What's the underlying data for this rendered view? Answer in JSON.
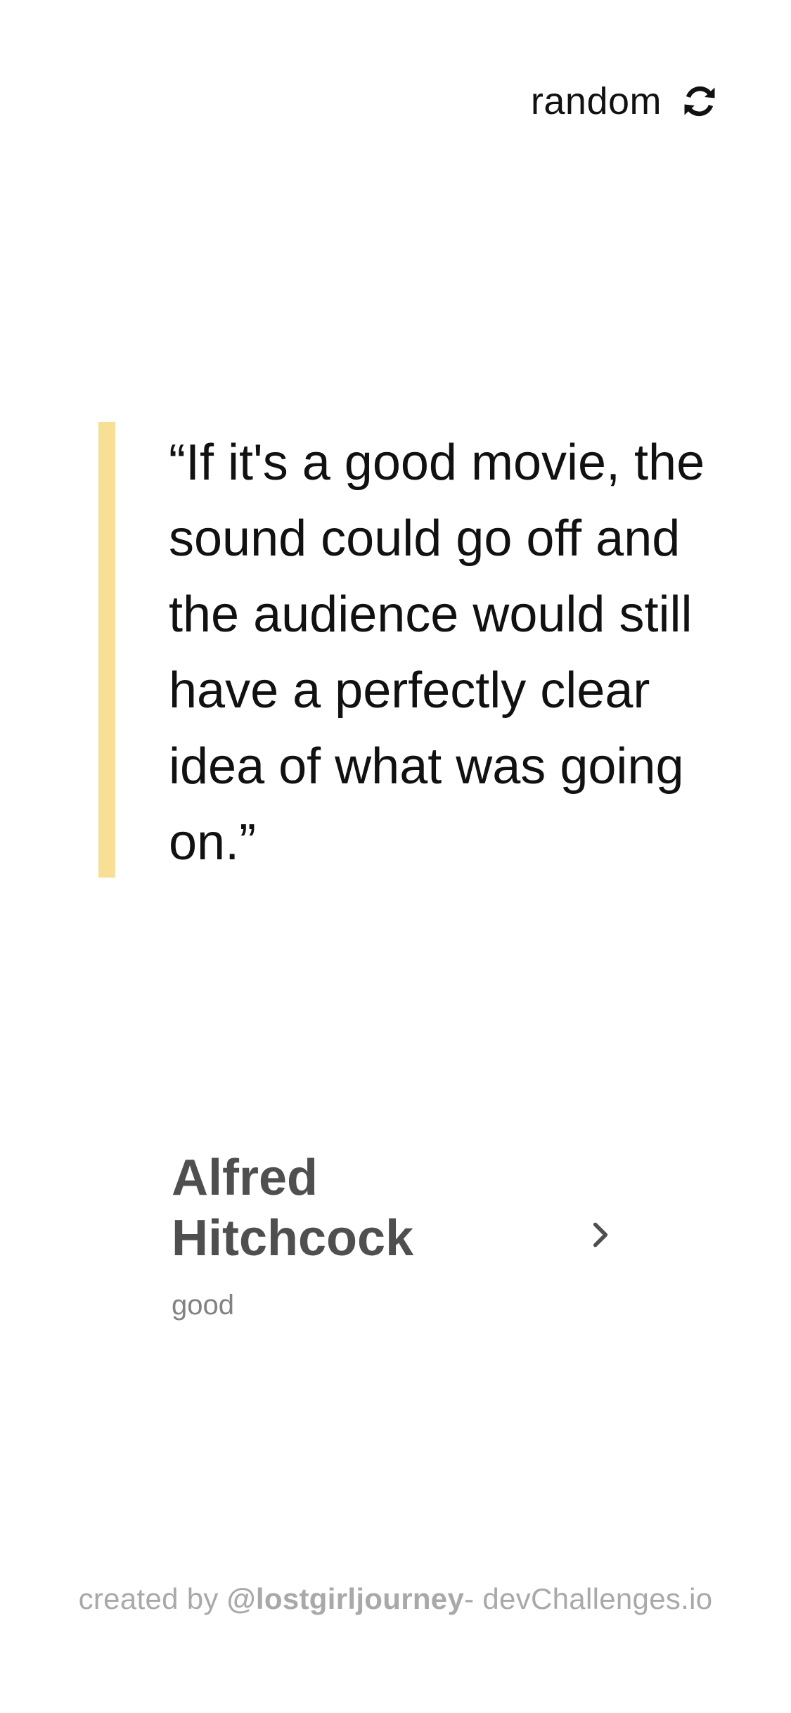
{
  "header": {
    "random_label": "random",
    "random_icon": "refresh-icon"
  },
  "quote": {
    "text": "“If it's a good movie, the sound could go off and the audience would still have a perfectly clear idea of what was going on.”",
    "accent_color": "#F7DF94"
  },
  "author": {
    "name": "Alfred Hitchcock",
    "genre": "good",
    "link_icon": "chevron-right-icon"
  },
  "footer": {
    "prefix": "created by ",
    "username": "@lostgirljourney",
    "suffix": "- devChallenges.io"
  },
  "colors": {
    "text_primary": "#111111",
    "author_text": "#4F4F4F",
    "genre_text": "#828282",
    "footer_text": "#A9A9A9",
    "background": "#FFFFFF"
  }
}
